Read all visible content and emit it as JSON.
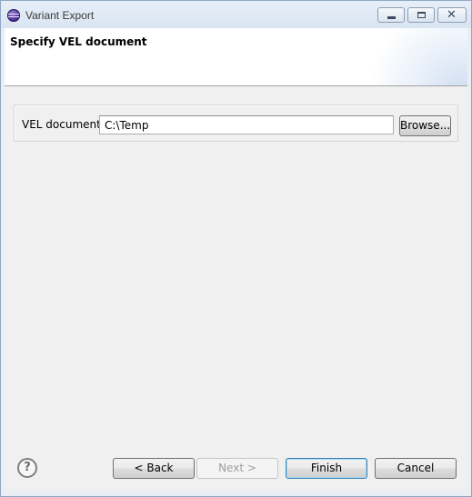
{
  "window": {
    "title": "Variant Export"
  },
  "page": {
    "title": "Specify VEL document"
  },
  "form": {
    "label": "VEL document:",
    "value": "C:\\Temp",
    "browse_label": "Browse..."
  },
  "buttons": {
    "help": "?",
    "back": "< Back",
    "next": "Next >",
    "finish": "Finish",
    "cancel": "Cancel"
  },
  "titlebar_controls": {
    "minimize": "",
    "maximize": "",
    "close": "✕"
  }
}
